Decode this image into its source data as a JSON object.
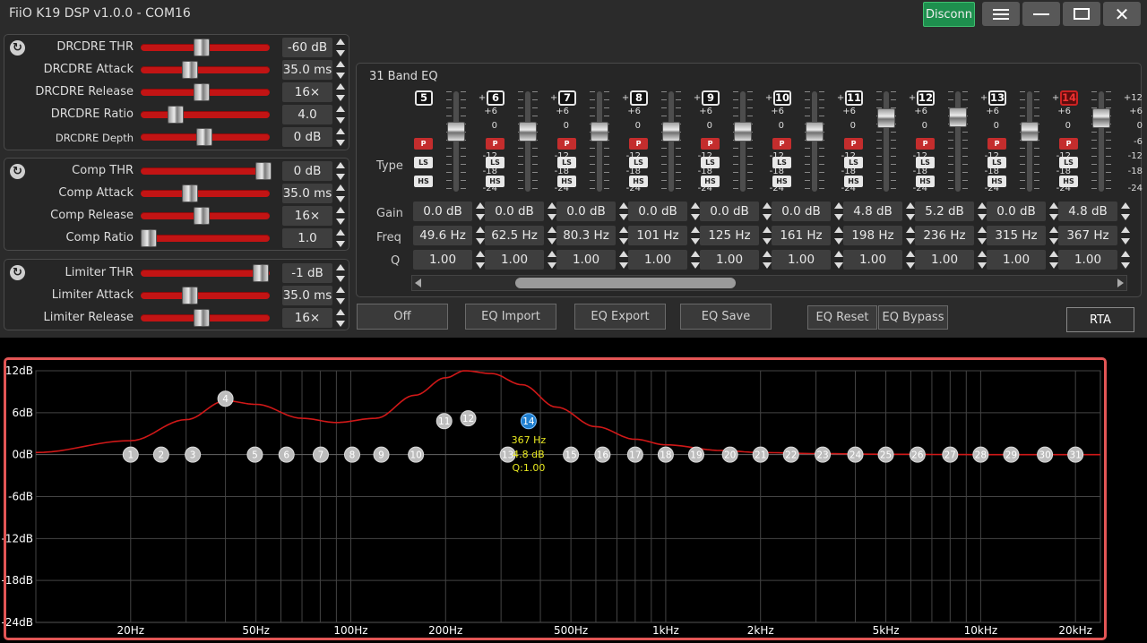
{
  "window": {
    "title": "FiiO K19 DSP v1.0.0 - COM16",
    "disconnect_label": "Disconn",
    "menu_icon": "hamburger-icon",
    "minimize_icon": "minimize-icon",
    "maximize_icon": "maximize-icon",
    "close_icon": "close-icon",
    "close_glyph": "✕"
  },
  "colors": {
    "accent_red": "#c21414",
    "curve_red": "#d01818",
    "active_band_blue": "#1f7fd0",
    "connect_green": "#1e8f4e",
    "highlight_border": "#e25555",
    "annotation_yellow": "#e8e820"
  },
  "drc_panel": {
    "reset_icon": "refresh-icon",
    "rows": [
      {
        "label": "DRCDRE THR",
        "value": "-60 dB",
        "level": 0.47
      },
      {
        "label": "DRCDRE Attack",
        "value": "35.0 ms",
        "level": 0.38
      },
      {
        "label": "DRCDRE Release",
        "value": "16×",
        "level": 0.47
      },
      {
        "label": "DRCDRE Ratio",
        "value": "4.0",
        "level": 0.27
      },
      {
        "label": "DRCDRE Depth",
        "value": "0 dB",
        "level": 0.49
      }
    ]
  },
  "comp_panel": {
    "reset_icon": "refresh-icon",
    "rows": [
      {
        "label": "Comp THR",
        "value": "0 dB",
        "level": 0.95
      },
      {
        "label": "Comp Attack",
        "value": "35.0 ms",
        "level": 0.38
      },
      {
        "label": "Comp Release",
        "value": "16×",
        "level": 0.47
      },
      {
        "label": "Comp Ratio",
        "value": "1.0",
        "level": 0.06
      }
    ]
  },
  "limiter_panel": {
    "reset_icon": "refresh-icon",
    "rows": [
      {
        "label": "Limiter THR",
        "value": "-1 dB",
        "level": 0.93
      },
      {
        "label": "Limiter Attack",
        "value": "35.0 ms",
        "level": 0.38
      },
      {
        "label": "Limiter Release",
        "value": "16×",
        "level": 0.47
      }
    ]
  },
  "eq": {
    "title": "31 Band EQ",
    "type_label": "Type",
    "gain_label": "Gain",
    "freq_label": "Freq",
    "q_label": "Q",
    "type_buttons": {
      "p": "P",
      "ls": "LS",
      "hs": "HS"
    },
    "scale": [
      "+12",
      "+6",
      "0",
      "-6",
      "-12",
      "-18",
      "-24"
    ],
    "bands": [
      {
        "num": "5",
        "gain": "0.0 dB",
        "freq": "49.6 Hz",
        "q": "1.00",
        "gain_db": 0.0,
        "active": false
      },
      {
        "num": "6",
        "gain": "0.0 dB",
        "freq": "62.5 Hz",
        "q": "1.00",
        "gain_db": 0.0,
        "active": false
      },
      {
        "num": "7",
        "gain": "0.0 dB",
        "freq": "80.3 Hz",
        "q": "1.00",
        "gain_db": 0.0,
        "active": false
      },
      {
        "num": "8",
        "gain": "0.0 dB",
        "freq": "101 Hz",
        "q": "1.00",
        "gain_db": 0.0,
        "active": false
      },
      {
        "num": "9",
        "gain": "0.0 dB",
        "freq": "125 Hz",
        "q": "1.00",
        "gain_db": 0.0,
        "active": false
      },
      {
        "num": "10",
        "gain": "0.0 dB",
        "freq": "161 Hz",
        "q": "1.00",
        "gain_db": 0.0,
        "active": false
      },
      {
        "num": "11",
        "gain": "4.8 dB",
        "freq": "198 Hz",
        "q": "1.00",
        "gain_db": 4.8,
        "active": false
      },
      {
        "num": "12",
        "gain": "5.2 dB",
        "freq": "236 Hz",
        "q": "1.00",
        "gain_db": 5.2,
        "active": false
      },
      {
        "num": "13",
        "gain": "0.0 dB",
        "freq": "315 Hz",
        "q": "1.00",
        "gain_db": 0.0,
        "active": false
      },
      {
        "num": "14",
        "gain": "4.8 dB",
        "freq": "367 Hz",
        "q": "1.00",
        "gain_db": 4.8,
        "active": true
      }
    ]
  },
  "actions": {
    "off": "Off",
    "import": "EQ Import",
    "export": "EQ Export",
    "save": "EQ Save",
    "reset": "EQ Reset",
    "bypass": "EQ Bypass",
    "rta": "RTA"
  },
  "chart_data": {
    "type": "line",
    "x_scale": "log",
    "xlim": [
      10,
      24000
    ],
    "ylim": [
      -24,
      12
    ],
    "grid": true,
    "y_ticks": [
      "12dB",
      "6dB",
      "0dB",
      "-6dB",
      "-12dB",
      "-18dB",
      "-24dB"
    ],
    "x_ticks": [
      {
        "label": "20Hz",
        "hz": 20
      },
      {
        "label": "50Hz",
        "hz": 50
      },
      {
        "label": "100Hz",
        "hz": 100
      },
      {
        "label": "200Hz",
        "hz": 200
      },
      {
        "label": "500Hz",
        "hz": 500
      },
      {
        "label": "1kHz",
        "hz": 1000
      },
      {
        "label": "2kHz",
        "hz": 2000
      },
      {
        "label": "5kHz",
        "hz": 5000
      },
      {
        "label": "10kHz",
        "hz": 10000
      },
      {
        "label": "20kHz",
        "hz": 20000
      }
    ],
    "response_curve": {
      "x": [
        10,
        20,
        30,
        40,
        50,
        70,
        90,
        120,
        160,
        200,
        230,
        280,
        350,
        450,
        600,
        800,
        1000,
        1500,
        2000,
        3000,
        5000,
        10000,
        24000
      ],
      "y": [
        0.3,
        2.0,
        5.0,
        7.7,
        7.2,
        5.2,
        4.6,
        5.2,
        8.5,
        11.0,
        12.0,
        11.6,
        10.0,
        6.8,
        4.0,
        2.2,
        1.4,
        0.6,
        0.3,
        0.15,
        0.05,
        0.0,
        0.0
      ]
    },
    "band_points": [
      {
        "n": "1",
        "hz": 20,
        "db": 0
      },
      {
        "n": "2",
        "hz": 25,
        "db": 0
      },
      {
        "n": "3",
        "hz": 31.5,
        "db": 0
      },
      {
        "n": "4",
        "hz": 40,
        "db": 8
      },
      {
        "n": "5",
        "hz": 49.6,
        "db": 0
      },
      {
        "n": "6",
        "hz": 62.5,
        "db": 0
      },
      {
        "n": "7",
        "hz": 80.3,
        "db": 0
      },
      {
        "n": "8",
        "hz": 101,
        "db": 0
      },
      {
        "n": "9",
        "hz": 125,
        "db": 0
      },
      {
        "n": "10",
        "hz": 161,
        "db": 0
      },
      {
        "n": "11",
        "hz": 198,
        "db": 4.8
      },
      {
        "n": "12",
        "hz": 236,
        "db": 5.2
      },
      {
        "n": "13",
        "hz": 315,
        "db": 0
      },
      {
        "n": "14",
        "hz": 367,
        "db": 4.8,
        "active": true
      },
      {
        "n": "15",
        "hz": 500,
        "db": 0
      },
      {
        "n": "16",
        "hz": 630,
        "db": 0
      },
      {
        "n": "17",
        "hz": 800,
        "db": 0
      },
      {
        "n": "18",
        "hz": 1000,
        "db": 0
      },
      {
        "n": "19",
        "hz": 1250,
        "db": 0
      },
      {
        "n": "20",
        "hz": 1600,
        "db": 0
      },
      {
        "n": "21",
        "hz": 2000,
        "db": 0
      },
      {
        "n": "22",
        "hz": 2500,
        "db": 0
      },
      {
        "n": "23",
        "hz": 3150,
        "db": 0
      },
      {
        "n": "24",
        "hz": 4000,
        "db": 0
      },
      {
        "n": "25",
        "hz": 5000,
        "db": 0
      },
      {
        "n": "26",
        "hz": 6300,
        "db": 0
      },
      {
        "n": "27",
        "hz": 8000,
        "db": 0
      },
      {
        "n": "28",
        "hz": 10000,
        "db": 0
      },
      {
        "n": "29",
        "hz": 12500,
        "db": 0
      },
      {
        "n": "30",
        "hz": 16000,
        "db": 0
      },
      {
        "n": "31",
        "hz": 20000,
        "db": 0
      }
    ],
    "annotation": {
      "freq": "367 Hz",
      "gain": "4.8 dB",
      "q": "Q:1.00"
    }
  }
}
